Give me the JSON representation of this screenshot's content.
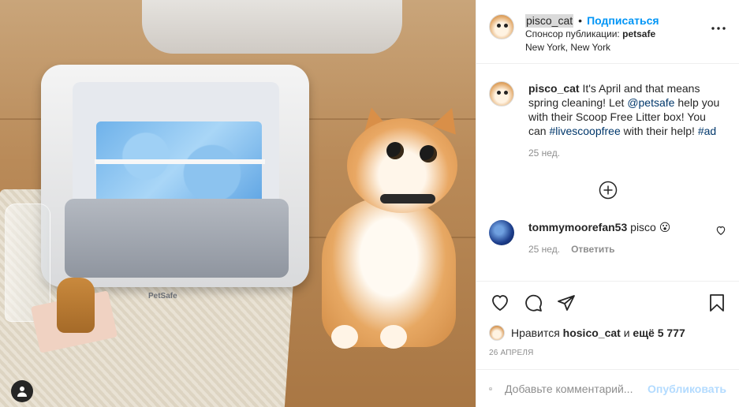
{
  "post": {
    "author": "pisco_cat",
    "dot": "•",
    "follow_label": "Подписаться",
    "sponsor_prefix": "Спонсор публикации:",
    "sponsor_name": "petsafe",
    "location": "New York, New York",
    "more_icon": "more-horizontal-icon"
  },
  "caption": {
    "author": "pisco_cat",
    "text_1": " It's April and that means spring cleaning! Let ",
    "mention": "@petsafe",
    "text_2": " help you with their Scoop Free Litter box! You can ",
    "hashtag_1": "#livescoopfree",
    "text_3": " with their help! ",
    "hashtag_2": "#ad",
    "time": "25 нед."
  },
  "load_more_icon": "plus-circle-icon",
  "comments": [
    {
      "author": "tommymoorefan53",
      "text": "pisco 😮",
      "time": "25 нед.",
      "reply_label": "Ответить"
    }
  ],
  "photo": {
    "brand_text": "PetSafe"
  },
  "likes": {
    "prefix": "Нравится ",
    "user": "hosico_cat",
    "middle": " и ",
    "count": "ещё 5 777"
  },
  "date": "26 АПРЕЛЯ",
  "add_comment": {
    "placeholder": "Добавьте комментарий...",
    "publish_label": "Опубликовать"
  },
  "colors": {
    "accent": "#0095f6",
    "publish_disabled": "#b3dbff",
    "link": "#00376b",
    "muted": "#8e8e8e"
  }
}
